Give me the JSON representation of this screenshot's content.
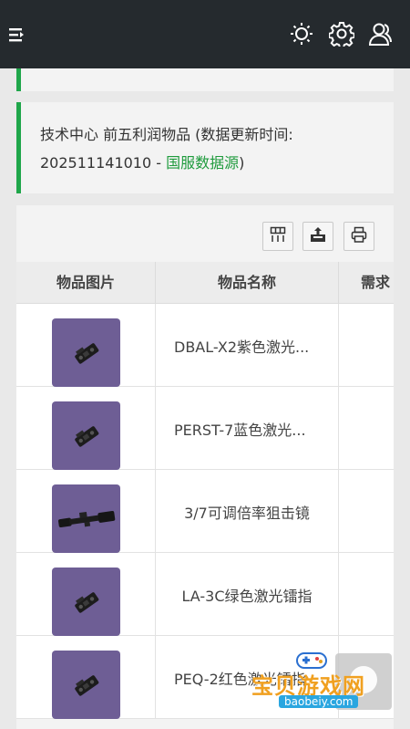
{
  "header": {
    "icons": [
      "menu-icon",
      "sun-icon",
      "gear-icon",
      "user-icon"
    ]
  },
  "notice": {
    "line1": "技术中心 前五利润物品 (数据更新时间:",
    "line2_prefix": "202511141010 - ",
    "link": "国服数据源",
    "line2_suffix": ")"
  },
  "table": {
    "toolbar_icons": [
      "columns-icon",
      "export-icon",
      "print-icon"
    ],
    "headers": [
      "物品图片",
      "物品名称",
      "需求"
    ],
    "rows": [
      {
        "name": "DBAL-X2紫色激光...",
        "image": "laser-device-icon"
      },
      {
        "name": "PERST-7蓝色激光...",
        "image": "laser-device-icon"
      },
      {
        "name": "3/7可调倍率狙击镜",
        "image": "scope-icon"
      },
      {
        "name": "LA-3C绿色激光镭指",
        "image": "laser-device-icon"
      },
      {
        "name": "PEQ-2红色激光镭指",
        "image": "laser-device-icon"
      }
    ]
  },
  "watermark": {
    "text": "宝贝游戏网",
    "url": "baobeiy.com"
  },
  "colors": {
    "topbar": "#252a2e",
    "accent": "#1fa64a",
    "item_bg": "#6e5e95"
  }
}
